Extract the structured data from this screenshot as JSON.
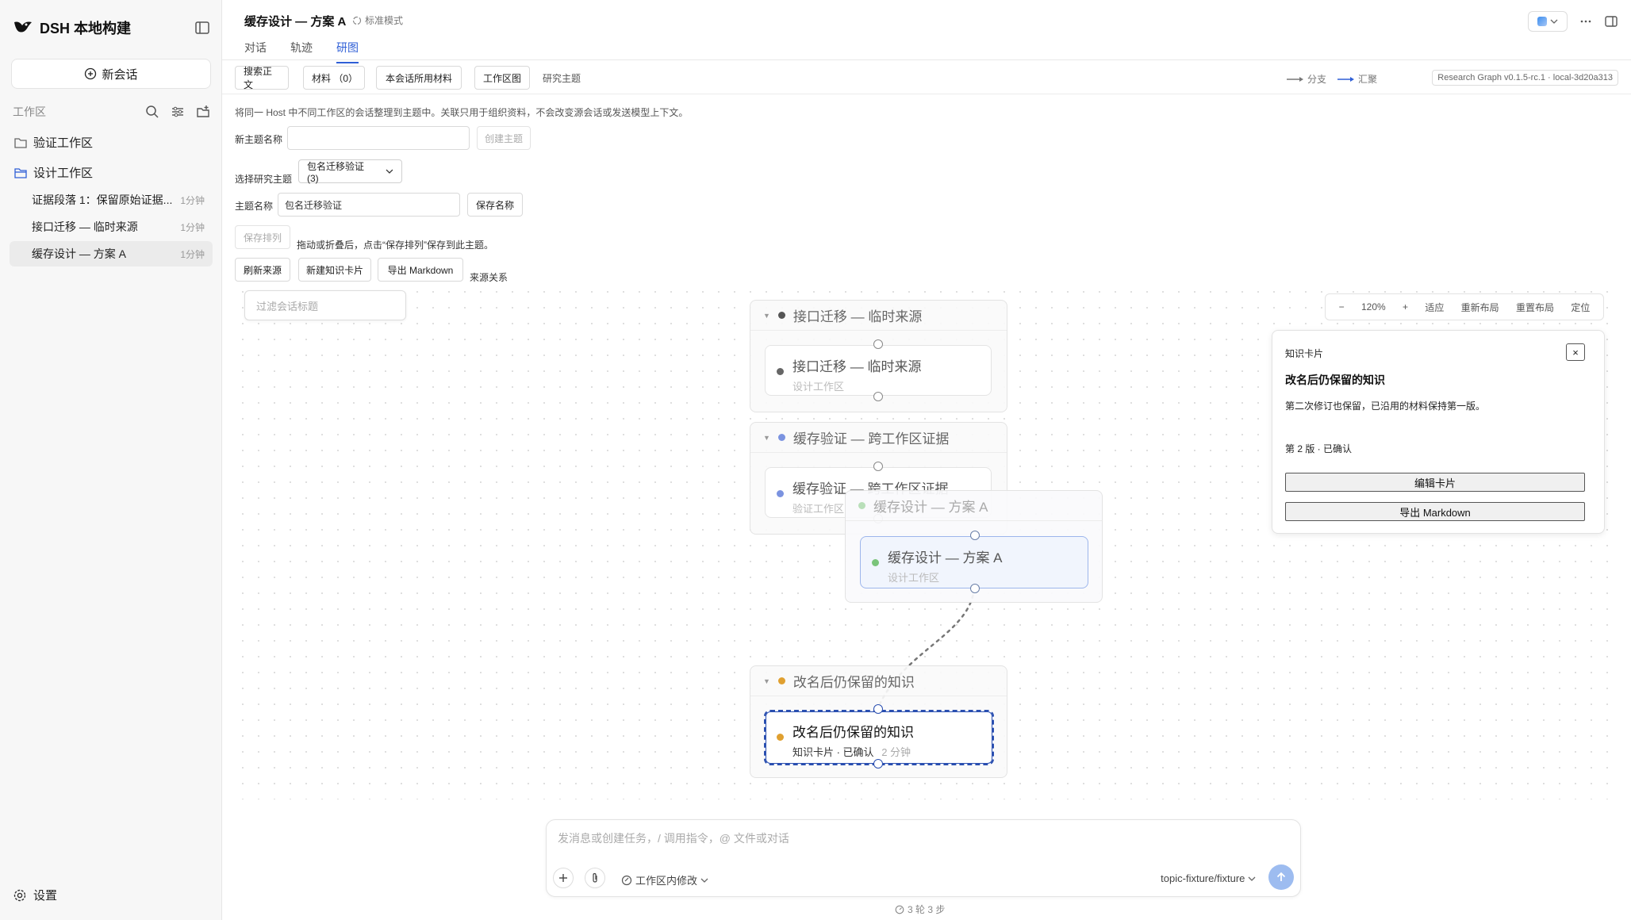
{
  "app": {
    "name": "DSH 本地构建"
  },
  "sidebar": {
    "new_chat": "新会话",
    "workspace_label": "工作区",
    "folders": [
      {
        "label": "验证工作区"
      },
      {
        "label": "设计工作区"
      }
    ],
    "sessions": [
      {
        "title": "证据段落 1：保留原始证据...",
        "time": "1分钟"
      },
      {
        "title": "接口迁移 — 临时来源",
        "time": "1分钟"
      },
      {
        "title": "缓存设计 — 方案 A",
        "time": "1分钟"
      }
    ],
    "settings": "设置"
  },
  "header": {
    "title": "缓存设计 — 方案 A",
    "mode": "标准模式",
    "tabs": [
      {
        "label": "对话"
      },
      {
        "label": "轨迹"
      },
      {
        "label": "研图"
      }
    ]
  },
  "toolbar": {
    "search_body": "搜索正文",
    "materials": "材料 （0）",
    "session_materials": "本会话所用材料",
    "workspace_graph": "工作区图",
    "research_topic": "研究主题",
    "legend_branch": "分支",
    "legend_merge": "汇聚",
    "version": "Research Graph v0.1.5-rc.1 · local-3d20a313"
  },
  "form": {
    "hint": "将同一 Host 中不同工作区的会话整理到主题中。关联只用于组织资料，不会改变源会话或发送模型上下文。",
    "new_topic_label": "新主题名称",
    "create_topic": "创建主题",
    "select_topic_label": "选择研究主题",
    "selected_topic": "包名迁移验证 (3)",
    "topic_name_label": "主题名称",
    "topic_name_value": "包名迁移验证",
    "save_name": "保存名称",
    "save_order": "保存排列",
    "save_order_hint": "拖动或折叠后，点击“保存排列”保存到此主题。",
    "refresh_sources": "刷新来源",
    "new_card": "新建知识卡片",
    "export_md": "导出 Markdown",
    "source_relations": "来源关系"
  },
  "canvas": {
    "filter_placeholder": "过滤会话标题",
    "zoom": {
      "minus": "−",
      "level": "120%",
      "plus": "+",
      "fit": "适应",
      "relayout": "重新布局",
      "reset_layout": "重置布局",
      "locate": "定位"
    },
    "groups": [
      {
        "title": "接口迁移 — 临时来源",
        "node_title": "接口迁移 — 临时来源",
        "node_sub": "设计工作区",
        "color": "#555555"
      },
      {
        "title": "缓存验证 — 跨工作区证据",
        "node_title": "缓存验证 — 跨工作区证据",
        "node_sub": "验证工作区",
        "color": "#7b93e0"
      },
      {
        "title": "缓存设计 — 方案 A",
        "node_title": "缓存设计 — 方案 A",
        "node_sub": "设计工作区",
        "color": "#7ac47a"
      },
      {
        "title": "改名后仍保留的知识",
        "node_title": "改名后仍保留的知识",
        "node_sub": "知识卡片 · 已确认",
        "node_time": "2 分钟",
        "color": "#e0a030"
      }
    ]
  },
  "knowledge_card": {
    "label": "知识卡片",
    "close": "×",
    "title": "改名后仍保留的知识",
    "body": "第二次修订也保留，已沿用的材料保持第一版。",
    "meta": "第 2 版 · 已确认",
    "edit": "编辑卡片",
    "export": "导出 Markdown"
  },
  "composer": {
    "placeholder": "发消息或创建任务，/ 调用指令，@ 文件或对话",
    "scope": "工作区内修改",
    "model": "topic-fixture/fixture",
    "steps": "3 轮 3 步"
  },
  "colors": {
    "accent": "#2f5fd6",
    "card_accent": "#e0a030"
  }
}
